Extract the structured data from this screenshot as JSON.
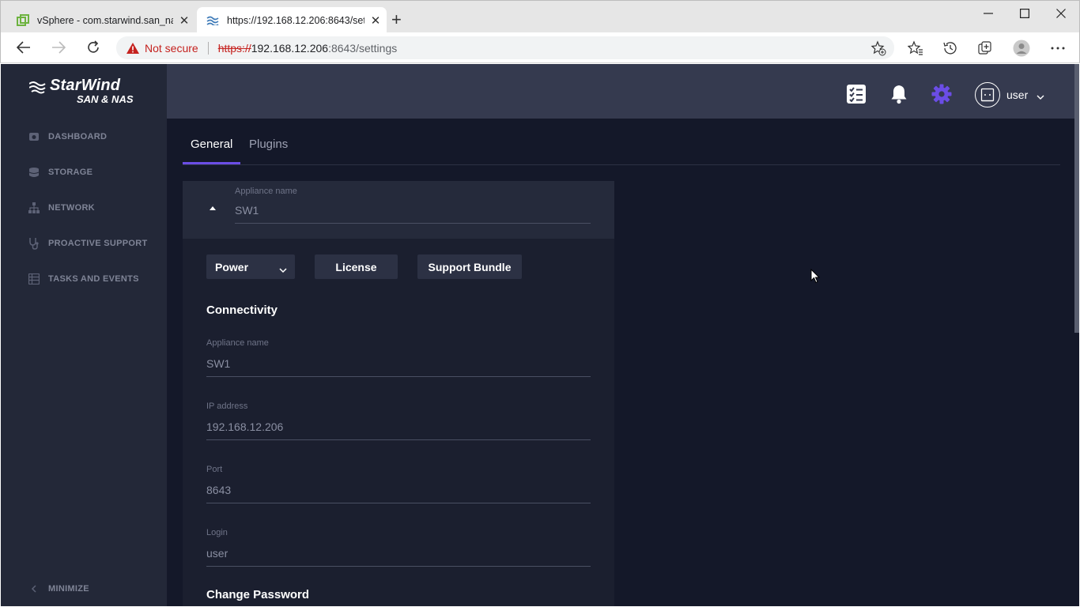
{
  "browser": {
    "tabs": [
      {
        "title": "vSphere - com.starwind.san_nas",
        "active": false
      },
      {
        "title": "https://192.168.12.206:8643/sett",
        "active": true
      }
    ],
    "security_label": "Not secure",
    "url_scheme": "https://",
    "url_host": "192.168.12.206",
    "url_rest": ":8643/settings"
  },
  "sidebar": {
    "logo_line1": "StarWind",
    "logo_line2": "SAN & NAS",
    "items": [
      {
        "label": "DASHBOARD",
        "icon": "dashboard-icon"
      },
      {
        "label": "STORAGE",
        "icon": "storage-icon"
      },
      {
        "label": "NETWORK",
        "icon": "network-icon"
      },
      {
        "label": "PROACTIVE SUPPORT",
        "icon": "stethoscope-icon"
      },
      {
        "label": "TASKS AND EVENTS",
        "icon": "tasks-icon"
      }
    ],
    "minimize_label": "MINIMIZE"
  },
  "header": {
    "username": "user",
    "accent_color": "#6b4de6"
  },
  "page_tabs": [
    {
      "label": "General",
      "active": true
    },
    {
      "label": "Plugins",
      "active": false
    }
  ],
  "appliance": {
    "head_label": "Appliance name",
    "head_value": "SW1",
    "actions": {
      "power": "Power",
      "license": "License",
      "support_bundle": "Support Bundle"
    },
    "connectivity_title": "Connectivity",
    "fields": [
      {
        "label": "Appliance name",
        "value": "SW1"
      },
      {
        "label": "IP address",
        "value": "192.168.12.206"
      },
      {
        "label": "Port",
        "value": "8643"
      },
      {
        "label": "Login",
        "value": "user"
      }
    ],
    "change_password_title": "Change Password"
  }
}
